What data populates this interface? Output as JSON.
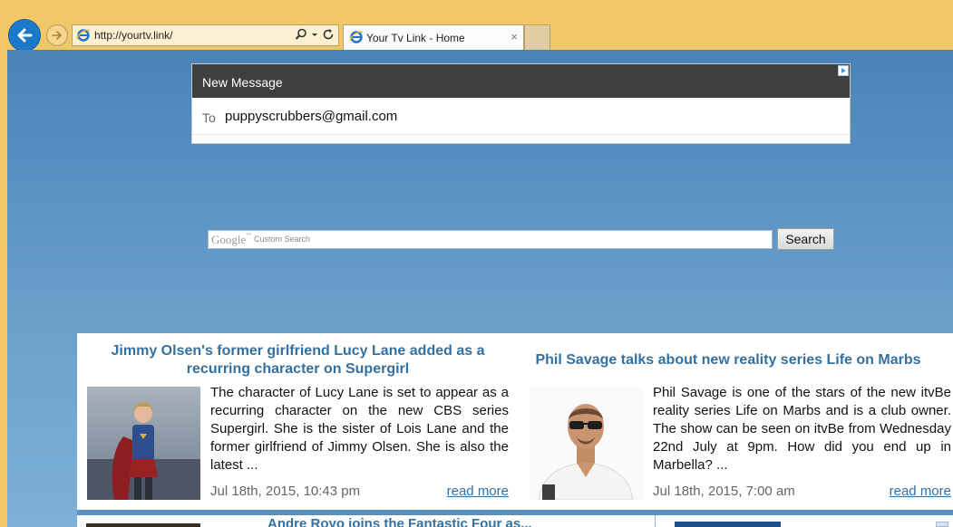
{
  "browser": {
    "url": "http://yourtv.link/",
    "tab_title": "Your Tv Link - Home",
    "tab_close": "×",
    "icons": [
      "back-arrow-icon",
      "forward-arrow-icon",
      "ie-logo-icon",
      "search-icon",
      "dropdown-icon",
      "refresh-icon",
      "close-icon"
    ]
  },
  "ad": {
    "header": "New Message",
    "to_label": "To",
    "email": "puppyscrubbers@gmail.com"
  },
  "search": {
    "logo": "Google",
    "logo_tm": "™",
    "placeholder": "Custom Search",
    "button": "Search"
  },
  "articles": [
    {
      "title": "Jimmy Olsen's former girlfriend Lucy Lane added as a recurring character on Supergirl",
      "text": "The character of Lucy Lane is set to appear as a recurring character on the new CBS series Supergirl. She is the sister of Lois Lane and the former girlfriend of Jimmy Olsen. She is also the latest ...",
      "date": "Jul 18th, 2015, 10:43 pm",
      "more": "read more"
    },
    {
      "title": "Phil Savage talks about new reality series Life on Marbs",
      "text": "Phil Savage is one of the stars of the new itvBe reality series Life on Marbs and is a club owner. The show can be seen on itvBe from Wednesday 22nd July at 9pm. How did you end up in Marbella? ...",
      "date": "Jul 18th, 2015, 7:00 am",
      "more": "read more"
    }
  ],
  "partial_row": {
    "title": "Andre Royo joins the Fantastic Four as..."
  },
  "colors": {
    "chrome": "#f2c76a",
    "page_bg": "#5a92c2",
    "link": "#34709f",
    "ad_header": "#3f3f3f"
  }
}
